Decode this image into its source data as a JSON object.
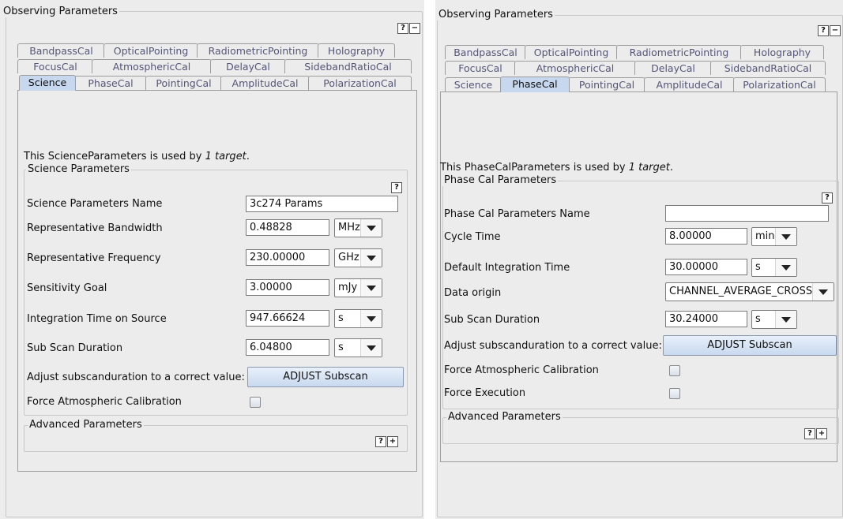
{
  "left": {
    "title": "Observing Parameters",
    "tabs_row1": [
      "BandpassCal",
      "OpticalPointing",
      "RadiometricPointing",
      "Holography"
    ],
    "tabs_row2": [
      "FocusCal",
      "AtmosphericCal",
      "DelayCal",
      "SidebandRatioCal"
    ],
    "tabs_row3": [
      "Science",
      "PhaseCal",
      "PointingCal",
      "AmplitudeCal",
      "PolarizationCal"
    ],
    "active_tab": "Science",
    "usage_prefix": "This ScienceParameters is used by ",
    "usage_italic": "1 target",
    "usage_suffix": ".",
    "section_title": "Science Parameters",
    "help": "?",
    "minus": "−",
    "plus": "+",
    "fields": {
      "name_label": "Science Parameters Name",
      "name_value": "3c274 Params",
      "bw_label": "Representative Bandwidth",
      "bw_value": "0.48828",
      "bw_unit": "MHz",
      "freq_label": "Representative Frequency",
      "freq_value": "230.00000",
      "freq_unit": "GHz",
      "sens_label": "Sensitivity Goal",
      "sens_value": "3.00000",
      "sens_unit": "mJy",
      "int_label": "Integration Time on Source",
      "int_value": "947.66624",
      "int_unit": "s",
      "sub_label": "Sub Scan Duration",
      "sub_value": "6.04800",
      "sub_unit": "s",
      "adj_label": "Adjust subscanduration to a correct value:",
      "adj_button": "ADJUST Subscan",
      "atm_label": "Force Atmospheric Calibration"
    },
    "advanced_title": "Advanced Parameters"
  },
  "right": {
    "title": "Observing Parameters",
    "tabs_row1": [
      "BandpassCal",
      "OpticalPointing",
      "RadiometricPointing",
      "Holography"
    ],
    "tabs_row2": [
      "FocusCal",
      "AtmosphericCal",
      "DelayCal",
      "SidebandRatioCal"
    ],
    "tabs_row3": [
      "Science",
      "PhaseCal",
      "PointingCal",
      "AmplitudeCal",
      "PolarizationCal"
    ],
    "active_tab": "PhaseCal",
    "usage_prefix": "This PhaseCalParameters is used by ",
    "usage_italic": "1 target",
    "usage_suffix": ".",
    "section_title": "Phase Cal Parameters",
    "help": "?",
    "minus": "−",
    "plus": "+",
    "fields": {
      "name_label": "Phase Cal Parameters Name",
      "name_value": "",
      "cycle_label": "Cycle Time",
      "cycle_value": "8.00000",
      "cycle_unit": "min",
      "def_label": "Default Integration Time",
      "def_value": "30.00000",
      "def_unit": "s",
      "origin_label": "Data origin",
      "origin_value": "CHANNEL_AVERAGE_CROSS",
      "sub_label": "Sub Scan Duration",
      "sub_value": "30.24000",
      "sub_unit": "s",
      "adj_label": "Adjust subscanduration to a correct value:",
      "adj_button": "ADJUST Subscan",
      "atm_label": "Force Atmospheric Calibration",
      "exec_label": "Force Execution"
    },
    "advanced_title": "Advanced Parameters"
  }
}
